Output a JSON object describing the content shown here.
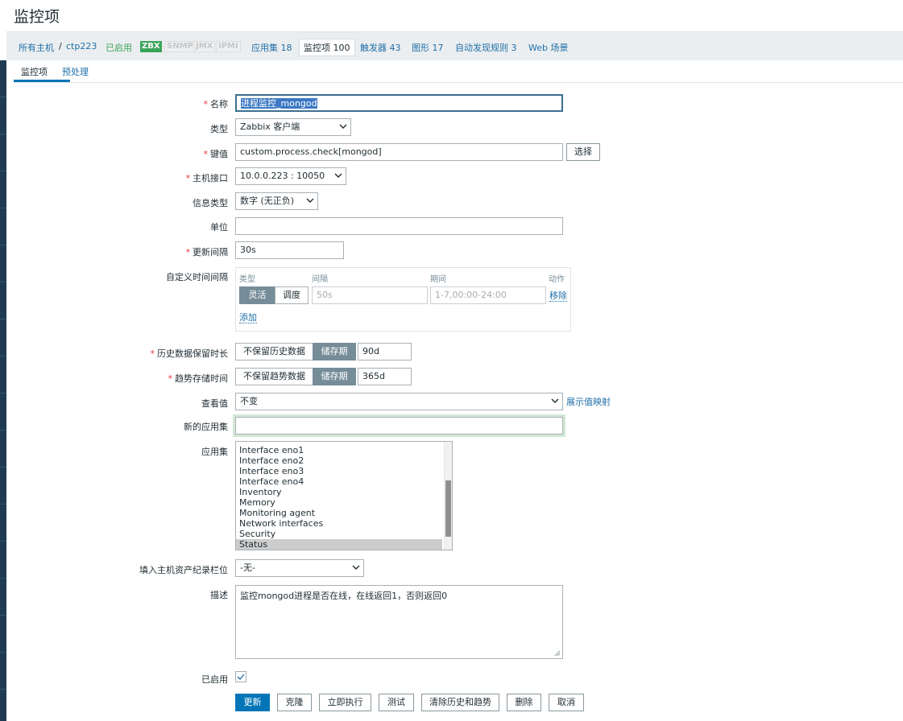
{
  "page": {
    "title": "监控项"
  },
  "nav": {
    "all_hosts": "所有主机",
    "separator": "/",
    "host": "ctp223",
    "status": "已启用",
    "protocols": [
      "ZBX",
      "SNMP",
      "JMX",
      "IPMI"
    ],
    "applications": "应用集 18",
    "items": "监控项 100",
    "triggers": "触发器 43",
    "graphs": "图形 17",
    "discovery": "自动发现规则 3",
    "web": "Web 场景"
  },
  "tabs": {
    "item": "监控项",
    "preprocessing": "预处理"
  },
  "form": {
    "name": {
      "label": "名称",
      "value": "进程监控_mongod"
    },
    "type": {
      "label": "类型",
      "value": "Zabbix 客户端"
    },
    "key": {
      "label": "键值",
      "value": "custom.process.check[mongod]",
      "select_button": "选择"
    },
    "interface": {
      "label": "主机接口",
      "value": "10.0.0.223 : 10050"
    },
    "info_type": {
      "label": "信息类型",
      "value": "数字 (无正负)"
    },
    "units": {
      "label": "单位",
      "value": ""
    },
    "update_interval": {
      "label": "更新间隔",
      "value": "30s"
    },
    "custom_intervals": {
      "label": "自定义时间间隔",
      "headers": {
        "type": "类型",
        "interval": "间隔",
        "period": "期间",
        "action": "动作"
      },
      "flexible": "灵活",
      "scheduling": "调度",
      "interval_placeholder": "50s",
      "period_placeholder": "1-7,00:00-24:00",
      "remove": "移除",
      "add": "添加"
    },
    "history": {
      "label": "历史数据保留时长",
      "no_keep": "不保留历史数据",
      "storage": "储存期",
      "value": "90d"
    },
    "trends": {
      "label": "趋势存储时间",
      "no_keep": "不保留趋势数据",
      "storage": "储存期",
      "value": "365d"
    },
    "valuemap": {
      "label": "查看值",
      "value": "不变",
      "link": "展示值映射"
    },
    "new_application": {
      "label": "新的应用集",
      "value": ""
    },
    "applications": {
      "label": "应用集",
      "options": [
        "Interface eno1",
        "Interface eno2",
        "Interface eno3",
        "Interface eno4",
        "Inventory",
        "Memory",
        "Monitoring agent",
        "Network interfaces",
        "Security",
        "Status"
      ],
      "selected": "Status"
    },
    "inventory_link": {
      "label": "填入主机资产纪录栏位",
      "value": "-无-"
    },
    "description": {
      "label": "描述",
      "value": "监控mongod进程是否在线，在线返回1，否则返回0"
    },
    "enabled": {
      "label": "已启用",
      "checked": true
    }
  },
  "buttons": {
    "update": "更新",
    "clone": "克隆",
    "execute_now": "立即执行",
    "test": "测试",
    "clear_history": "清除历史和趋势",
    "delete": "删除",
    "cancel": "取消"
  },
  "colors": {
    "accent": "#0275b8",
    "link": "#1f6fa8",
    "required": "#e33734",
    "enabled": "#3aa35a",
    "segment_on": "#768d99"
  }
}
